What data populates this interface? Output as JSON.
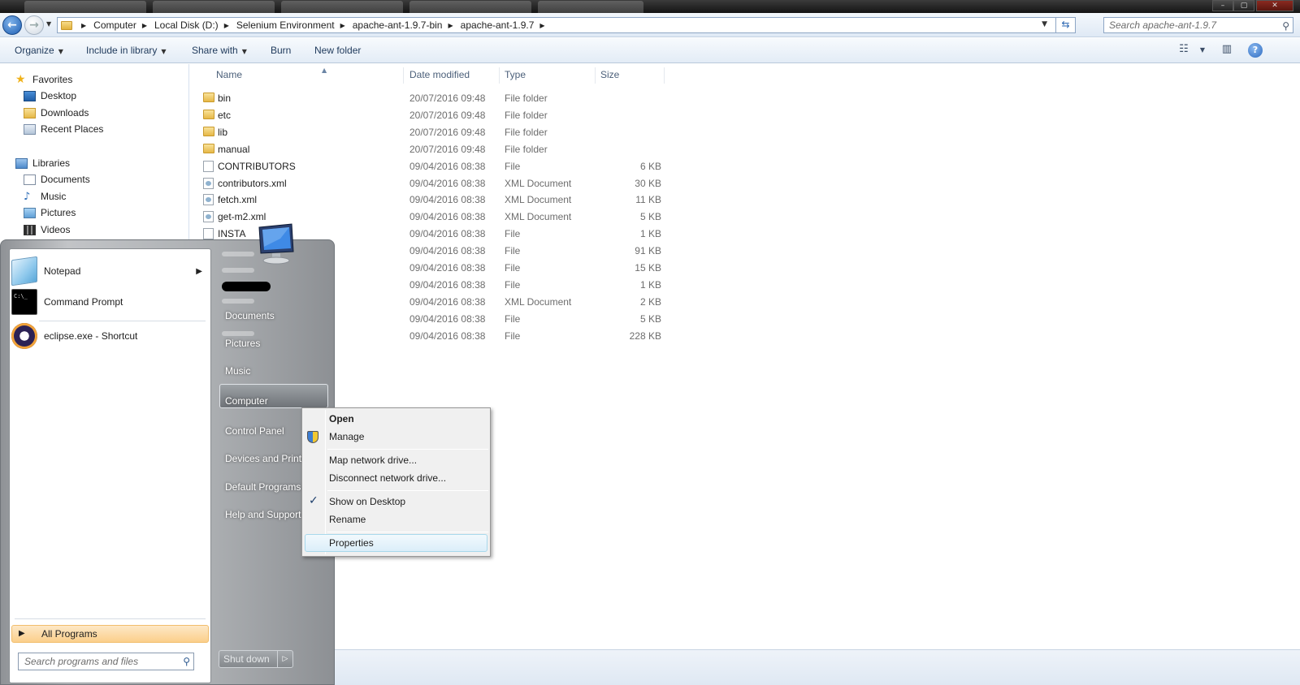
{
  "address": {
    "crumbs": [
      "Computer",
      "Local Disk (D:)",
      "Selenium Environment",
      "apache-ant-1.9.7-bin",
      "apache-ant-1.9.7"
    ],
    "search_placeholder": "Search apache-ant-1.9.7"
  },
  "toolbar": {
    "organize": "Organize",
    "include_in_library": "Include in library",
    "share_with": "Share with",
    "burn": "Burn",
    "new_folder": "New folder"
  },
  "nav": {
    "favorites": "Favorites",
    "desktop": "Desktop",
    "downloads": "Downloads",
    "recent_places": "Recent Places",
    "libraries": "Libraries",
    "documents": "Documents",
    "music": "Music",
    "pictures": "Pictures",
    "videos": "Videos"
  },
  "columns": {
    "name": "Name",
    "date": "Date modified",
    "type": "Type",
    "size": "Size"
  },
  "files": [
    {
      "name": "bin",
      "date": "20/07/2016 09:48",
      "type": "File folder",
      "size": "",
      "kind": "folder"
    },
    {
      "name": "etc",
      "date": "20/07/2016 09:48",
      "type": "File folder",
      "size": "",
      "kind": "folder"
    },
    {
      "name": "lib",
      "date": "20/07/2016 09:48",
      "type": "File folder",
      "size": "",
      "kind": "folder"
    },
    {
      "name": "manual",
      "date": "20/07/2016 09:48",
      "type": "File folder",
      "size": "",
      "kind": "folder"
    },
    {
      "name": "CONTRIBUTORS",
      "date": "09/04/2016 08:38",
      "type": "File",
      "size": "6 KB",
      "kind": "file"
    },
    {
      "name": "contributors.xml",
      "date": "09/04/2016 08:38",
      "type": "XML Document",
      "size": "30 KB",
      "kind": "xml"
    },
    {
      "name": "fetch.xml",
      "date": "09/04/2016 08:38",
      "type": "XML Document",
      "size": "11 KB",
      "kind": "xml"
    },
    {
      "name": "get-m2.xml",
      "date": "09/04/2016 08:38",
      "type": "XML Document",
      "size": "5 KB",
      "kind": "xml"
    },
    {
      "name": "INSTA",
      "date": "09/04/2016 08:38",
      "type": "File",
      "size": "1 KB",
      "kind": "file"
    },
    {
      "name": "",
      "date": "09/04/2016 08:38",
      "type": "File",
      "size": "91 KB",
      "kind": "none"
    },
    {
      "name": "",
      "date": "09/04/2016 08:38",
      "type": "File",
      "size": "15 KB",
      "kind": "none"
    },
    {
      "name": "",
      "date": "09/04/2016 08:38",
      "type": "File",
      "size": "1 KB",
      "kind": "none"
    },
    {
      "name": "",
      "date": "09/04/2016 08:38",
      "type": "XML Document",
      "size": "2 KB",
      "kind": "none"
    },
    {
      "name": "",
      "date": "09/04/2016 08:38",
      "type": "File",
      "size": "5 KB",
      "kind": "none"
    },
    {
      "name": "",
      "date": "09/04/2016 08:38",
      "type": "File",
      "size": "228 KB",
      "kind": "none"
    }
  ],
  "start_menu": {
    "programs": [
      "Notepad",
      "Command Prompt",
      "eclipse.exe - Shortcut"
    ],
    "all_programs": "All Programs",
    "search_placeholder": "Search programs and files",
    "right": {
      "documents": "Documents",
      "pictures": "Pictures",
      "music": "Music",
      "computer": "Computer",
      "control_panel": "Control Panel",
      "devices_printers": "Devices and Printe",
      "default_programs": "Default Programs",
      "help_support": "Help and Support"
    },
    "shutdown": "Shut down"
  },
  "context_menu": {
    "open": "Open",
    "manage": "Manage",
    "map_drive": "Map network drive...",
    "disconnect_drive": "Disconnect network drive...",
    "show_on_desktop": "Show on Desktop",
    "rename": "Rename",
    "properties": "Properties"
  },
  "icons": {
    "back": "back-arrow-icon",
    "forward": "forward-arrow-icon",
    "refresh": "refresh-icon",
    "search": "search-icon",
    "view": "view-options-icon",
    "preview": "preview-pane-icon",
    "help": "help-icon",
    "shield": "uac-shield-icon",
    "check": "checkmark-icon"
  }
}
